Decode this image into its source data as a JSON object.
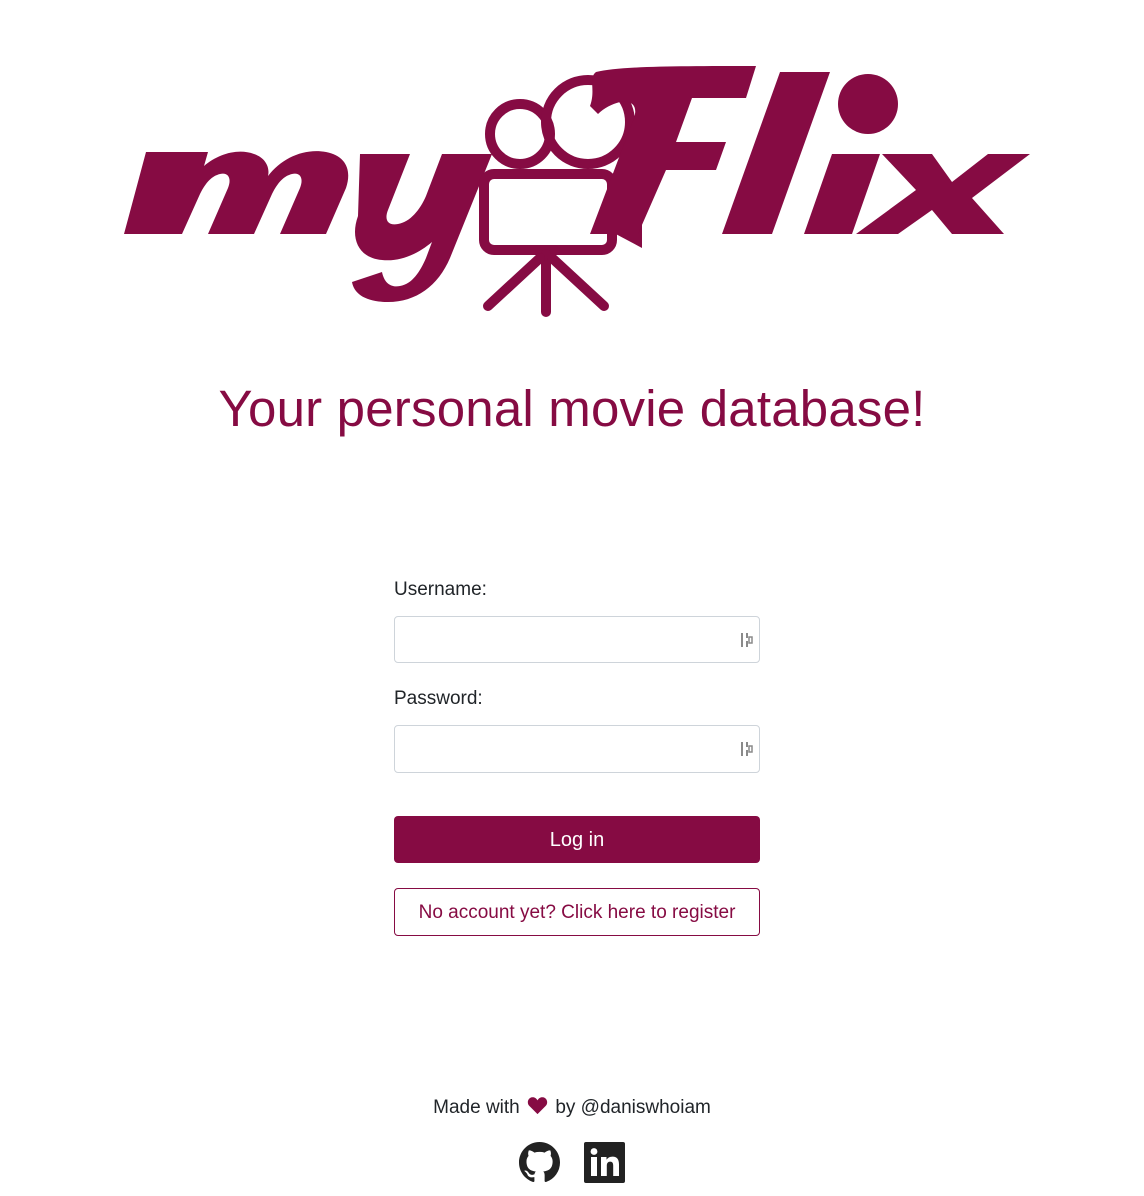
{
  "brand": {
    "logo_text": "myFlix",
    "tagline": "Your personal movie database!",
    "accent_color": "#860b43"
  },
  "form": {
    "username_label": "Username:",
    "username_value": "",
    "password_label": "Password:",
    "password_value": "",
    "password_manager_icon": "password-manager-icon",
    "login_label": "Log in",
    "register_label": "No account yet? Click here to register"
  },
  "footer": {
    "made_with": "Made with",
    "heart_icon": "heart-icon",
    "by_text": "by @daniswhoiam",
    "links": [
      {
        "icon": "github-icon"
      },
      {
        "icon": "linkedin-icon"
      }
    ]
  }
}
